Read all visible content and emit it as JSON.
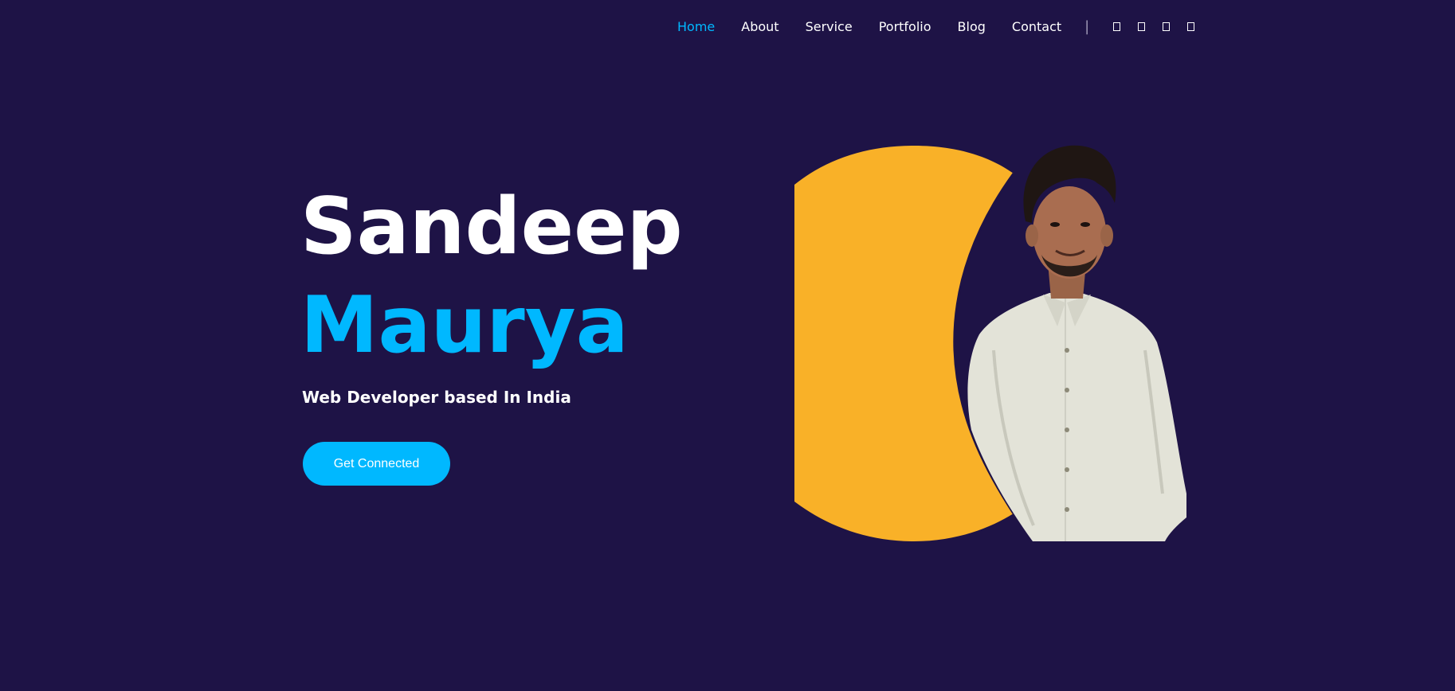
{
  "nav": {
    "links": [
      {
        "label": "Home",
        "active": true
      },
      {
        "label": "About",
        "active": false
      },
      {
        "label": "Service",
        "active": false
      },
      {
        "label": "Portfolio",
        "active": false
      },
      {
        "label": "Blog",
        "active": false
      },
      {
        "label": "Contact",
        "active": false
      }
    ],
    "separator": "|",
    "social_icons": [
      "social-icon-1",
      "social-icon-2",
      "social-icon-3",
      "social-icon-4"
    ]
  },
  "hero": {
    "first_name": "Sandeep",
    "last_name": "Maurya",
    "tagline": "Web Developer based In India",
    "cta_label": "Get Connected"
  },
  "colors": {
    "background": "#1e1346",
    "accent": "#00b8ff",
    "shape": "#f9b128",
    "text": "#ffffff"
  },
  "icons": {
    "portrait": "person-photo"
  }
}
